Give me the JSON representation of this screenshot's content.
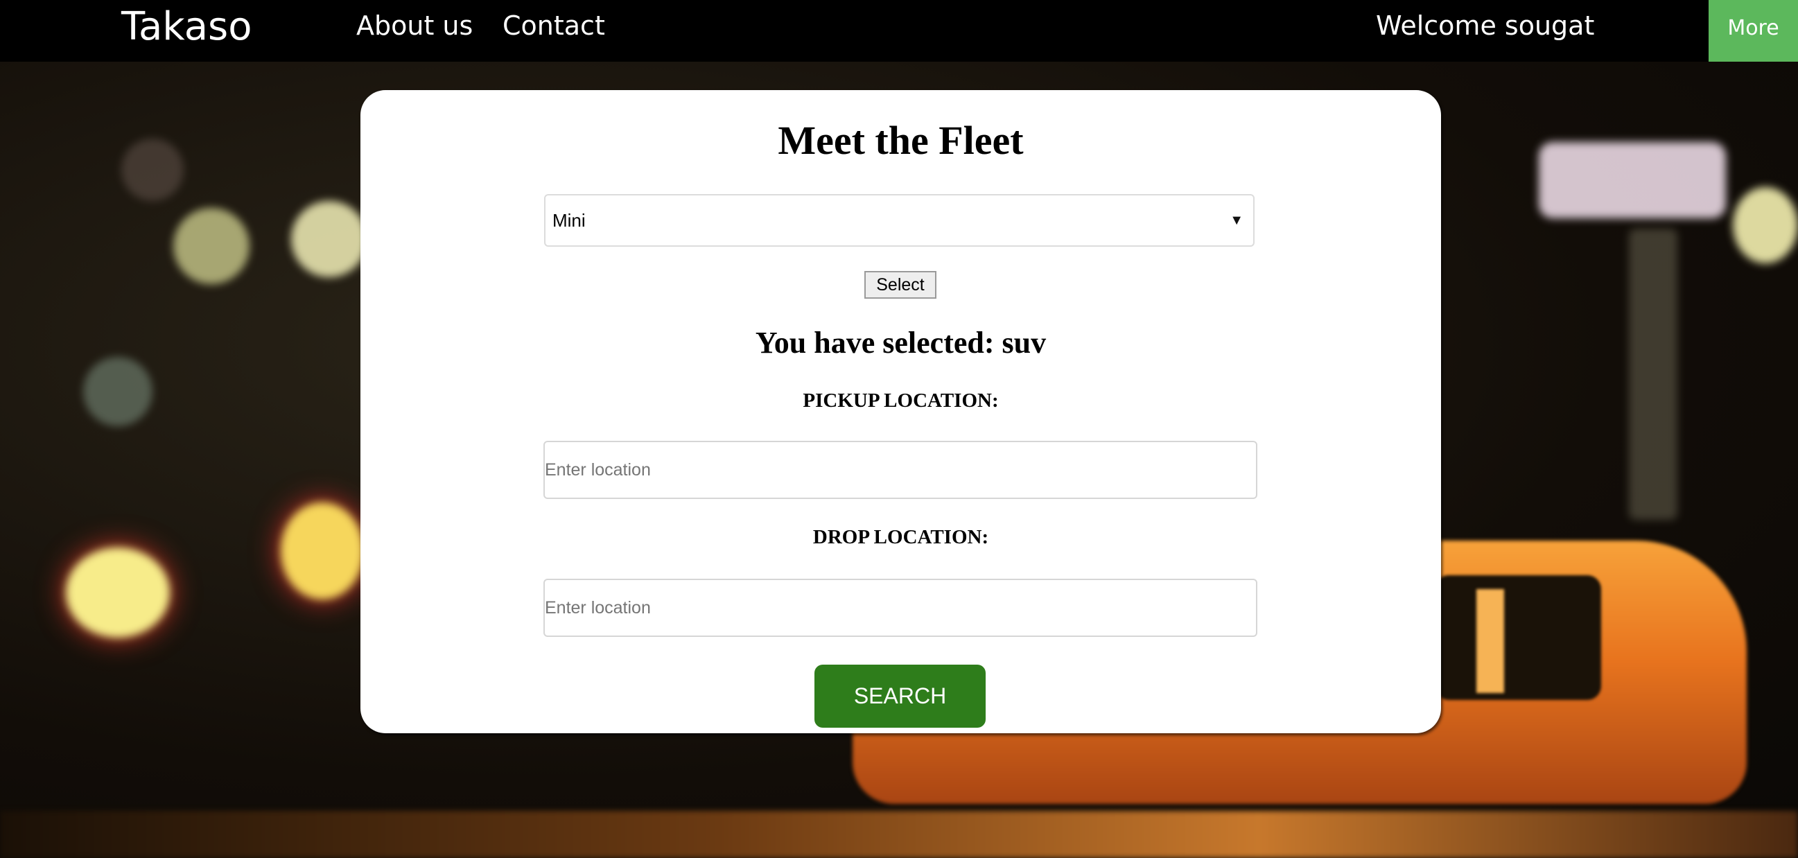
{
  "navbar": {
    "brand": "Takaso",
    "links": [
      {
        "label": "About us"
      },
      {
        "label": "Contact"
      }
    ],
    "welcome": "Welcome sougat",
    "more_label": "More"
  },
  "card": {
    "title": "Meet the Fleet",
    "fleet_select": {
      "selected": "Mini"
    },
    "select_button": "Select",
    "selected_text": "You have selected: suv",
    "pickup_label": "PICKUP LOCATION:",
    "pickup_placeholder": "Enter location",
    "drop_label": "DROP LOCATION:",
    "drop_placeholder": "Enter location",
    "search_button": "SEARCH"
  },
  "colors": {
    "navbar_bg": "#000000",
    "more_button": "#5cb85c",
    "search_button": "#2e7d1b",
    "card_bg": "#ffffff"
  }
}
